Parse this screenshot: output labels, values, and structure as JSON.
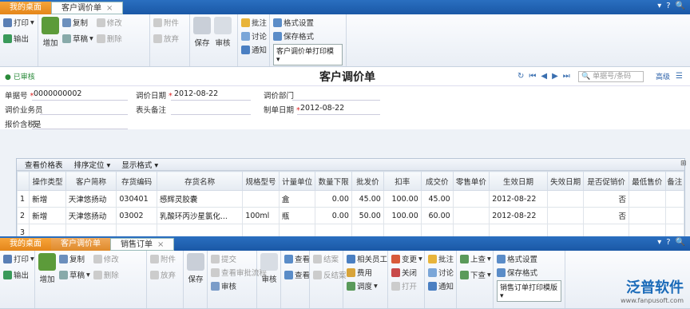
{
  "top_tabs": [
    "我的桌面",
    "客户调价单"
  ],
  "ribbon1": {
    "print": "打印",
    "export": "输出",
    "add": "增加",
    "copy": "复制",
    "draft": "草稿",
    "edit": "修改",
    "delete": "删除",
    "attach": "附件",
    "discard": "放弃",
    "save": "保存",
    "audit": "审核",
    "approve": "批注",
    "discuss": "讨论",
    "notify": "通知",
    "format_set": "格式设置",
    "save_format": "保存格式",
    "print_template": "客户调价单打印模"
  },
  "title": {
    "status": "已审核",
    "text": "客户调价单",
    "search_placeholder": "单据号/条码",
    "advanced": "高级"
  },
  "form": {
    "doc_no_label": "单据号",
    "doc_no": "0000000002",
    "date_label": "调价日期",
    "date": "2012-08-22",
    "dept_label": "调价部门",
    "sales_label": "调价业务员",
    "remark_label": "表头备注",
    "make_date_label": "制单日期",
    "make_date": "2012-08-22",
    "tax_label": "报价含税",
    "tax": "是"
  },
  "grid": {
    "toolbar": [
      "查看价格表",
      "排序定位",
      "显示格式"
    ],
    "headers": [
      "",
      "操作类型",
      "客户简称",
      "存货编码",
      "存货名称",
      "规格型号",
      "计量单位",
      "数量下限",
      "批发价",
      "扣率",
      "成交价",
      "零售单价",
      "生效日期",
      "失效日期",
      "是否促销价",
      "最低售价",
      "备注"
    ],
    "rows": [
      [
        "1",
        "新增",
        "天津悠扬动",
        "030401",
        "感辉灵胶囊",
        "",
        "盒",
        "0.00",
        "45.00",
        "100.00",
        "45.00",
        "",
        "2012-08-22",
        "",
        "否",
        "",
        ""
      ],
      [
        "2",
        "新增",
        "天津悠扬动",
        "03002",
        "乳酸环丙沙星氯化...",
        "100ml",
        "瓶",
        "0.00",
        "50.00",
        "100.00",
        "60.00",
        "",
        "2012-08-22",
        "",
        "否",
        "",
        ""
      ],
      [
        "3",
        "",
        "",
        "",
        "",
        "",
        "",
        "",
        "",
        "",
        "",
        "",
        "",
        "",
        "",
        "",
        ""
      ]
    ]
  },
  "bottom_tabs": [
    "我的桌面",
    "客户调价单",
    "销售订单"
  ],
  "ribbon2": {
    "print": "打印",
    "export": "输出",
    "add": "增加",
    "copy": "复制",
    "draft": "草稿",
    "edit": "修改",
    "delete": "删除",
    "attach": "附件",
    "discard": "放弃",
    "save": "保存",
    "submit": "提交",
    "view_route": "查看审批流程",
    "audit": "审核",
    "settle": "结案",
    "unsettle": "反结案",
    "review": "查看",
    "close": "关闭",
    "open": "打开",
    "relate": "相关员工",
    "cost": "费用",
    "dispatch": "调度",
    "change": "变更",
    "shut": "关闭",
    "open2": "打开",
    "approve": "批注",
    "discuss": "讨论",
    "notify": "通知",
    "up": "上查",
    "down": "下查",
    "format_set": "格式设置",
    "save_format": "保存格式",
    "print_template": "销售订单打印模版"
  },
  "logo": {
    "name": "泛普软件",
    "url": "www.fanpusoft.com"
  }
}
